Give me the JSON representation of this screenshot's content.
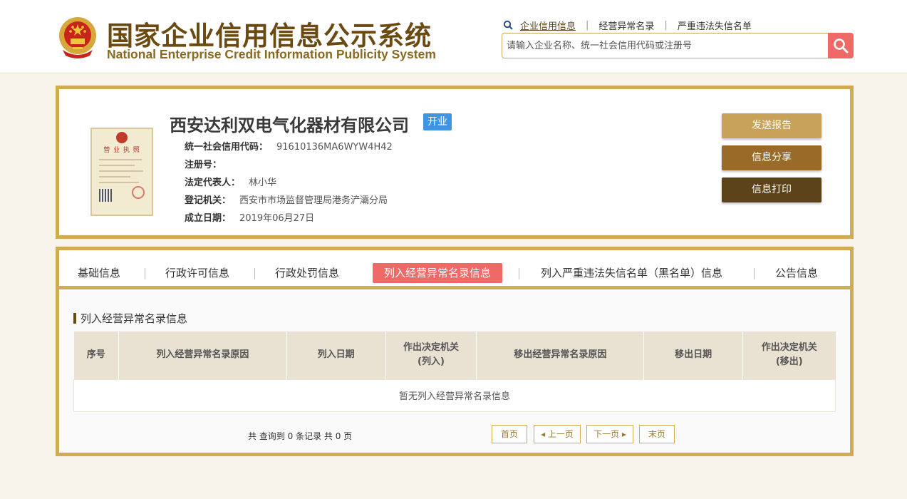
{
  "header": {
    "title_cn": "国家企业信用信息公示系统",
    "title_en": "National Enterprise Credit Information Publicity System",
    "links": [
      "企业信用信息",
      "经营异常名录",
      "严重违法失信名单"
    ],
    "search_placeholder": "请输入企业名称、统一社会信用代码或注册号"
  },
  "company": {
    "license_title": "营 业 执 照",
    "name": "西安达利双电气化器材有限公司",
    "status": "开业",
    "fields": [
      {
        "label": "统一社会信用代码：",
        "value": "91610136MA6WYW4H42"
      },
      {
        "label": "注册号：",
        "value": ""
      },
      {
        "label": "法定代表人：",
        "value": "林小华"
      },
      {
        "label": "登记机关：",
        "value": "西安市市场监督管理局港务浐灞分局"
      },
      {
        "label": "成立日期：",
        "value": "2019年06月27日"
      }
    ],
    "actions": {
      "report": "发送报告",
      "share": "信息分享",
      "print": "信息打印"
    }
  },
  "tabs": [
    "基础信息",
    "行政许可信息",
    "行政处罚信息",
    "列入经营异常名录信息",
    "列入严重违法失信名单（黑名单）信息",
    "公告信息"
  ],
  "active_tab": 3,
  "section": {
    "title": "列入经营异常名录信息",
    "columns": [
      "序号",
      "列入经营异常名录原因",
      "列入日期",
      "作出决定机关\n(列入)",
      "移出经营异常名录原因",
      "移出日期",
      "作出决定机关\n(移出)"
    ],
    "empty_text": "暂无列入经营异常名录信息"
  },
  "pagination": {
    "summary": "共 查询到 0 条记录 共 0 页",
    "first": "首页",
    "prev": "上一页",
    "next": "下一页",
    "last": "末页"
  },
  "colors": {
    "gold": "#d1ab53",
    "accent_red": "#ef6a66",
    "badge_blue": "#3f95e2",
    "brown": "#6b4a12"
  }
}
